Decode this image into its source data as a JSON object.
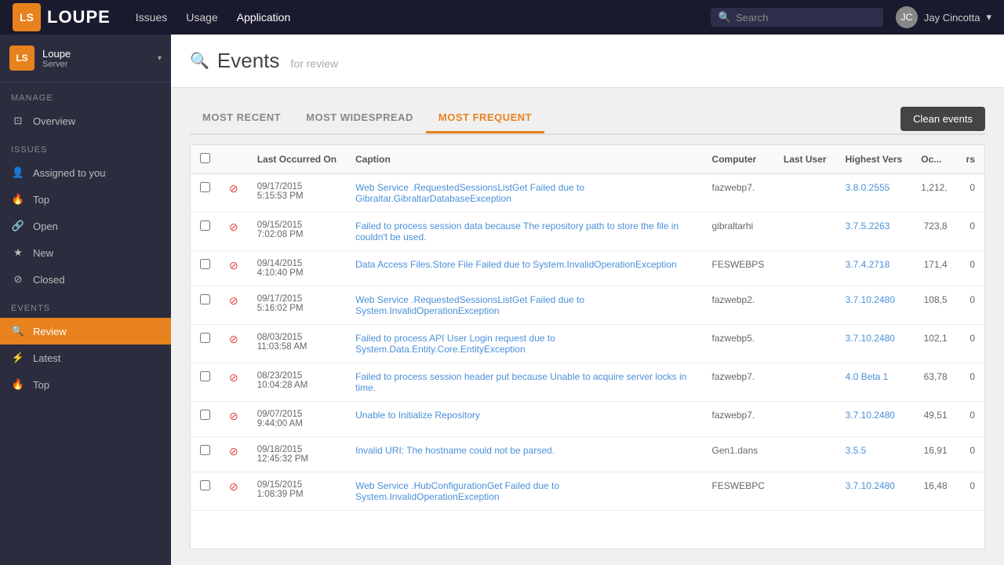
{
  "topnav": {
    "logo_initials": "LS",
    "logo_name": "LOUPE",
    "links": [
      "Issues",
      "Usage",
      "Application"
    ],
    "search_placeholder": "Search",
    "user_name": "Jay Cincotta"
  },
  "sidebar": {
    "server_badge": "LS",
    "server_name": "Loupe",
    "server_sub": "Server",
    "manage_title": "MANAGE",
    "manage_items": [
      {
        "id": "overview",
        "label": "Overview",
        "icon": "⊡"
      }
    ],
    "issues_title": "ISSUES",
    "issues_items": [
      {
        "id": "assigned",
        "label": "Assigned to you",
        "icon": "👤"
      },
      {
        "id": "top",
        "label": "Top",
        "icon": "🔥"
      },
      {
        "id": "open",
        "label": "Open",
        "icon": "🔗"
      },
      {
        "id": "new",
        "label": "New",
        "icon": "★"
      },
      {
        "id": "closed",
        "label": "Closed",
        "icon": "⊘"
      }
    ],
    "events_title": "EVENTS",
    "events_items": [
      {
        "id": "review",
        "label": "Review",
        "icon": "🔍",
        "active": true
      },
      {
        "id": "latest",
        "label": "Latest",
        "icon": "⚡"
      },
      {
        "id": "top-events",
        "label": "Top",
        "icon": "🔥"
      }
    ]
  },
  "main": {
    "header_title": "Events",
    "header_sub": "for review",
    "tabs": [
      {
        "id": "most-recent",
        "label": "MOST RECENT"
      },
      {
        "id": "most-widespread",
        "label": "MOST WIDESPREAD"
      },
      {
        "id": "most-frequent",
        "label": "MOST FREQUENT",
        "active": true
      }
    ],
    "clean_btn": "Clean events",
    "table": {
      "columns": [
        "",
        "",
        "Last Occurred On",
        "Caption",
        "Computer",
        "Last User",
        "Highest Vers",
        "Oc...",
        "rs"
      ],
      "rows": [
        {
          "date": "09/17/2015\n5:15:53 PM",
          "caption": "Web Service .RequestedSessionsListGet Failed due to Gibraltar.GibraltarDatabaseException",
          "computer": "fazwebp7.",
          "user": "",
          "version": "3.8.0.2555",
          "occ": "1,212,",
          "rs": "0"
        },
        {
          "date": "09/15/2015\n7:02:08 PM",
          "caption": "Failed to process session data because The repository path to store the file in couldn't be used.",
          "computer": "gibraltarhi",
          "user": "",
          "version": "3.7.5.2263",
          "occ": "723,8",
          "rs": "0"
        },
        {
          "date": "09/14/2015\n4:10:40 PM",
          "caption": "Data Access Files.Store File Failed due to System.InvalidOperationException",
          "computer": "FESWEBPS",
          "user": "",
          "version": "3.7.4.2718",
          "occ": "171,4",
          "rs": "0"
        },
        {
          "date": "09/17/2015\n5:16:02 PM",
          "caption": "Web Service .RequestedSessionsListGet Failed due to System.InvalidOperationException",
          "computer": "fazwebp2.",
          "user": "",
          "version": "3.7.10.2480",
          "occ": "108,5",
          "rs": "0"
        },
        {
          "date": "08/03/2015\n11:03:58 AM",
          "caption": "Failed to process API User Login request due to System.Data.Entity.Core.EntityException",
          "computer": "fazwebp5.",
          "user": "",
          "version": "3.7.10.2480",
          "occ": "102,1",
          "rs": "0"
        },
        {
          "date": "08/23/2015\n10:04:28 AM",
          "caption": "Failed to process session header put because Unable to acquire server locks in time.",
          "computer": "fazwebp7.",
          "user": "",
          "version": "4.0 Beta 1",
          "occ": "63,78",
          "rs": "0"
        },
        {
          "date": "09/07/2015\n9:44:00 AM",
          "caption": "Unable to Initialize Repository",
          "computer": "fazwebp7.",
          "user": "",
          "version": "3.7.10.2480",
          "occ": "49,51",
          "rs": "0"
        },
        {
          "date": "09/18/2015\n12:45:32 PM",
          "caption": "Invalid URI: The hostname could not be parsed.",
          "computer": "Gen1.dans",
          "user": "",
          "version": "3.5.5",
          "occ": "16,91",
          "rs": "0"
        },
        {
          "date": "09/15/2015\n1:08:39 PM",
          "caption": "Web Service .HubConfigurationGet Failed due to System.InvalidOperationException",
          "computer": "FESWEBPC",
          "user": "",
          "version": "3.7.10.2480",
          "occ": "16,48",
          "rs": "0"
        }
      ]
    }
  }
}
